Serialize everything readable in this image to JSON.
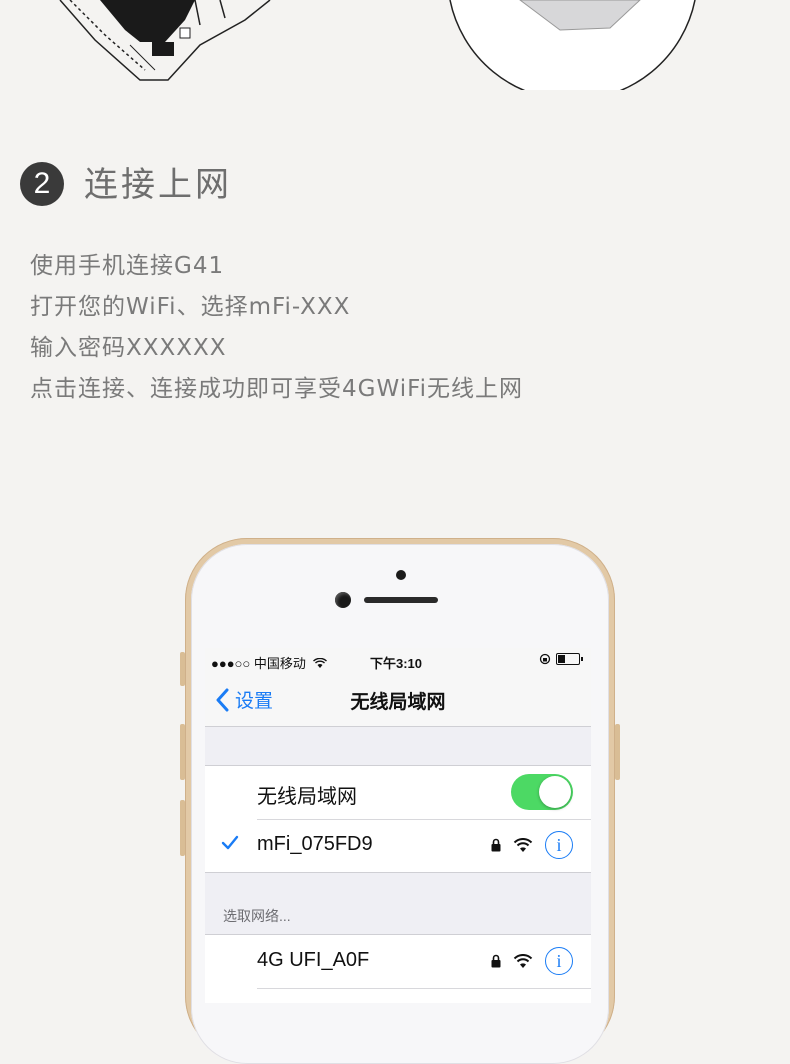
{
  "step": {
    "number": "2",
    "title": "连接上网"
  },
  "instructions": [
    "使用手机连接G41",
    "打开您的WiFi、选择mFi-XXX",
    "输入密码XXXXXX",
    "点击连接、连接成功即可享受4GWiFi无线上网"
  ],
  "phone": {
    "status_bar": {
      "carrier": "●●●○○ 中国移动",
      "time": "下午3:10"
    },
    "nav": {
      "back_label": "设置",
      "title": "无线局域网"
    },
    "wifi_toggle": {
      "label": "无线局域网",
      "on": true
    },
    "connected_network": {
      "name": "mFi_075FD9",
      "locked": true,
      "info_label": "i"
    },
    "section_header": "选取网络...",
    "networks": [
      {
        "name": "4G UFI_A0F",
        "locked": true,
        "info_label": "i"
      }
    ],
    "colors": {
      "accent": "#1a7cf5",
      "toggle_on": "#4cd964",
      "phone_frame": "#e2c9a6"
    }
  }
}
